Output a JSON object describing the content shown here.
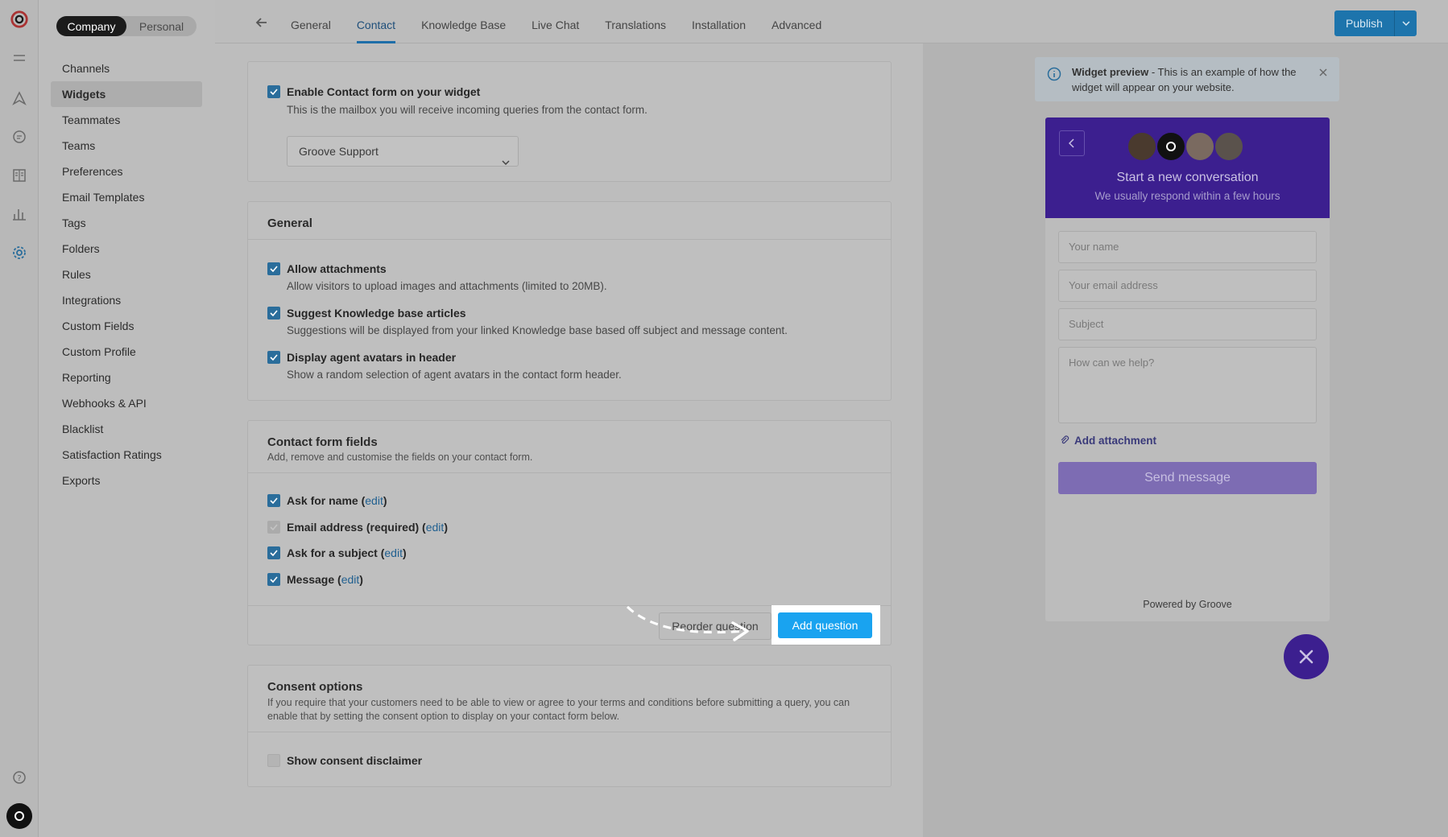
{
  "sidebar": {
    "toggle": {
      "company": "Company",
      "personal": "Personal"
    },
    "items": [
      {
        "label": "Channels"
      },
      {
        "label": "Widgets"
      },
      {
        "label": "Teammates"
      },
      {
        "label": "Teams"
      },
      {
        "label": "Preferences"
      },
      {
        "label": "Email Templates"
      },
      {
        "label": "Tags"
      },
      {
        "label": "Folders"
      },
      {
        "label": "Rules"
      },
      {
        "label": "Integrations"
      },
      {
        "label": "Custom Fields"
      },
      {
        "label": "Custom Profile"
      },
      {
        "label": "Reporting"
      },
      {
        "label": "Webhooks & API"
      },
      {
        "label": "Blacklist"
      },
      {
        "label": "Satisfaction Ratings"
      },
      {
        "label": "Exports"
      }
    ],
    "active": "Widgets"
  },
  "tabs": [
    {
      "label": "General"
    },
    {
      "label": "Contact"
    },
    {
      "label": "Knowledge Base"
    },
    {
      "label": "Live Chat"
    },
    {
      "label": "Translations"
    },
    {
      "label": "Installation"
    },
    {
      "label": "Advanced"
    }
  ],
  "active_tab": "Contact",
  "publish": {
    "label": "Publish"
  },
  "contact": {
    "enable_label": "Enable Contact form on your widget",
    "enable_desc": "This is the mailbox you will receive incoming queries from the contact form.",
    "mailbox_value": "Groove Support"
  },
  "general": {
    "title": "General",
    "options": [
      {
        "label": "Allow attachments",
        "desc": "Allow visitors to upload images and attachments (limited to 20MB)."
      },
      {
        "label": "Suggest Knowledge base articles",
        "desc": "Suggestions will be displayed from your linked Knowledge base based off subject and message content."
      },
      {
        "label": "Display agent avatars in header",
        "desc": "Show a random selection of agent avatars in the contact form header."
      }
    ]
  },
  "fields": {
    "title": "Contact form fields",
    "desc": "Add, remove and customise the fields on your contact form.",
    "items": [
      {
        "label": "Ask for name",
        "edit": "edit"
      },
      {
        "label": "Email address (required)",
        "edit": "edit"
      },
      {
        "label": "Ask for a subject",
        "edit": "edit"
      },
      {
        "label": "Message",
        "edit": "edit"
      }
    ],
    "reorder_label": "Reorder question",
    "add_label": "Add question"
  },
  "consent": {
    "title": "Consent options",
    "desc": "If you require that your customers need to be able to view or agree to your terms and conditions before submitting a query, you can enable that by setting the consent option to display on your contact form below.",
    "option_label": "Show consent disclaimer"
  },
  "preview": {
    "info_title": "Widget preview",
    "info_text": " - This is an example of how the widget will appear on your website.",
    "title": "Start a new conversation",
    "subtitle": "We usually respond within a few hours",
    "name_placeholder": "Your name",
    "email_placeholder": "Your email address",
    "subject_placeholder": "Subject",
    "message_placeholder": "How can we help?",
    "attach_label": "Add attachment",
    "send_label": "Send message",
    "powered": "Powered by Groove",
    "accent": "#3c1f8f"
  }
}
